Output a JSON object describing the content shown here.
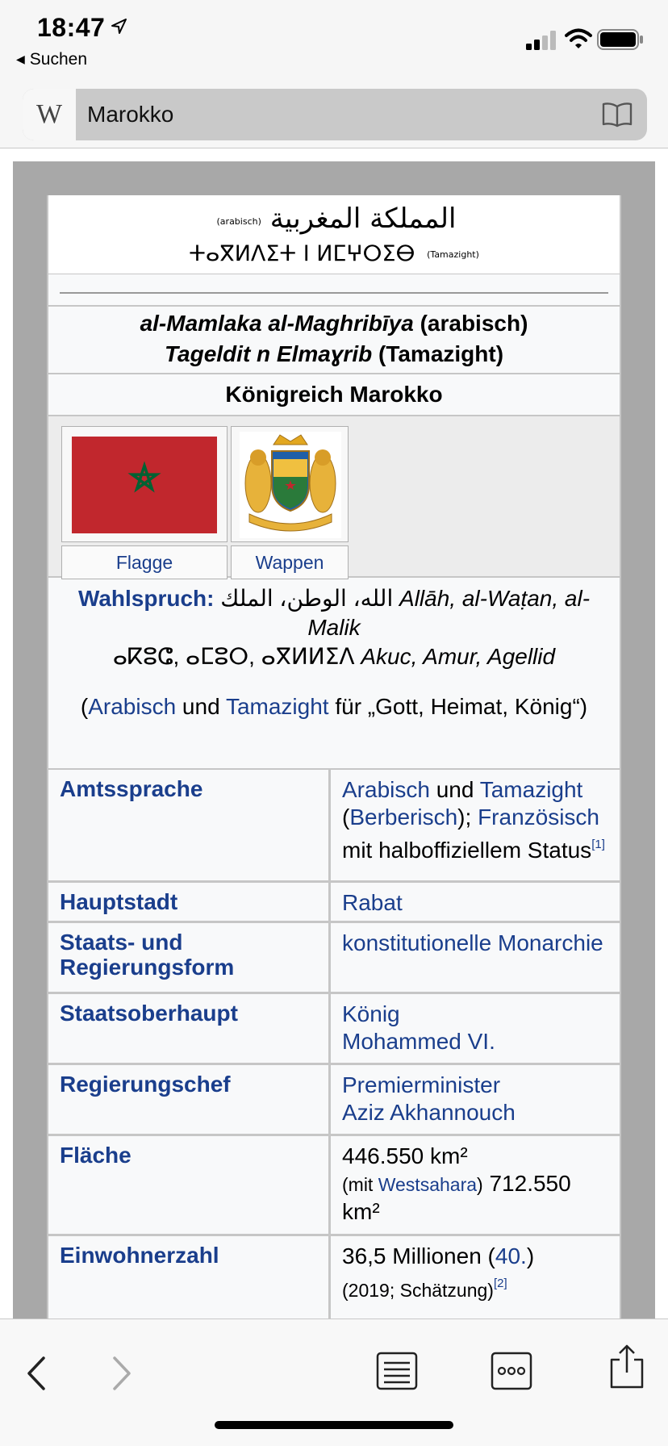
{
  "status": {
    "time": "18:47",
    "back_app": "Suchen"
  },
  "browser": {
    "url_text": "Marokko"
  },
  "infobox": {
    "native_arabic": "المملكة المغربية",
    "native_arabic_tag": "(arabisch)",
    "native_berber": "ⵜⴰⴳⵍⴷⵉⵜ ⵏ ⵍⵎⵖⵔⵉⴱ",
    "native_berber_tag": "(Tamazight)",
    "translit1_italic": "al-Mamlaka al-Maghribīya",
    "translit1_lang": " (arabisch)",
    "translit2_italic": "Tageldit n Elmaɣrib",
    "translit2_lang": " (Tamazight)",
    "country_name": "Königreich Marokko",
    "flag_caption": "Flagge",
    "coa_caption": "Wappen",
    "motto_label": "Wahlspruch:",
    "motto_arabic": "الله، الوطن، الملك",
    "motto_translit": "Allāh, al-Waṭan, al-Malik",
    "motto_berber": "ⴰⴽⵓⵛ, ⴰⵎⵓⵔ, ⴰⴳⵍⵍⵉⴷ",
    "motto_berber_translit": "Akuc, Amur, Agellid",
    "motto_trans_open": "(",
    "motto_trans_link1": "Arabisch",
    "motto_trans_und": " und ",
    "motto_trans_link2": "Tamazight",
    "motto_trans_rest": " für „Gott, Heimat, König“)",
    "rows": {
      "amtssprache": {
        "key": "Amtssprache",
        "l1": "Arabisch",
        "t1": " und ",
        "l2": "Tamazight",
        "t2": " (",
        "l3": "Berberisch",
        "t3": ");",
        "l4": "Französisch",
        "t4": " mit halboffiziellem Status",
        "ref": "[1]"
      },
      "hauptstadt": {
        "key": "Hauptstadt",
        "l1": "Rabat"
      },
      "staatsform": {
        "key": "Staats- und Regierungsform",
        "l1": "konstitutionelle Monarchie"
      },
      "staatsoberhaupt": {
        "key": "Staatsoberhaupt",
        "l1": "König",
        "l2": "Mohammed VI."
      },
      "regierungschef": {
        "key": "Regierungschef",
        "l1": "Premierminister",
        "l2": "Aziz Akhannouch"
      },
      "flaeche": {
        "key": "Fläche",
        "v1": "446.550 km²",
        "mit_open": "(mit ",
        "link": "Westsahara",
        "mit_close": ")",
        "v2": " 712.550 km²"
      },
      "einwohner": {
        "key": "Einwohnerzahl",
        "v1": "36,5 Millionen (",
        "rank": "40.",
        "v1_close": ")",
        "est": "(2019; Schätzung)",
        "ref": "[2]"
      }
    }
  },
  "colors": {
    "link": "#1a3e8c",
    "flag_red": "#c1272d",
    "flag_green": "#006233"
  }
}
